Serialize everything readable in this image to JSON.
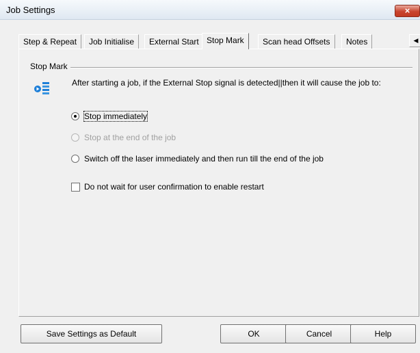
{
  "window": {
    "title": "Job Settings",
    "close_label": "×"
  },
  "tabs": [
    {
      "label": "Step & Repeat"
    },
    {
      "label": "Job Initialise"
    },
    {
      "label": "External Start"
    },
    {
      "label": "Stop Mark"
    },
    {
      "label": "Scan head Offsets"
    },
    {
      "label": "Notes"
    }
  ],
  "tab_scroll": {
    "left": "◀",
    "right": "▶"
  },
  "stop_mark": {
    "group_label": "Stop Mark",
    "description": "After starting a job, if the External Stop signal is detected||then it will cause the job to:",
    "options": [
      {
        "label": "Stop immediately",
        "selected": true,
        "enabled": true
      },
      {
        "label": "Stop at the end of the job",
        "selected": false,
        "enabled": false
      },
      {
        "label": "Switch off the laser immediately and then run till the end of the job",
        "selected": false,
        "enabled": true
      }
    ],
    "no_confirm": {
      "label": "Do not wait for user confirmation to enable restart",
      "checked": false
    }
  },
  "buttons": {
    "save_default": "Save Settings as Default",
    "ok": "OK",
    "cancel": "Cancel",
    "help": "Help"
  },
  "colors": {
    "icon_blue": "#1e7fd8",
    "close_red": "#c9452f"
  }
}
